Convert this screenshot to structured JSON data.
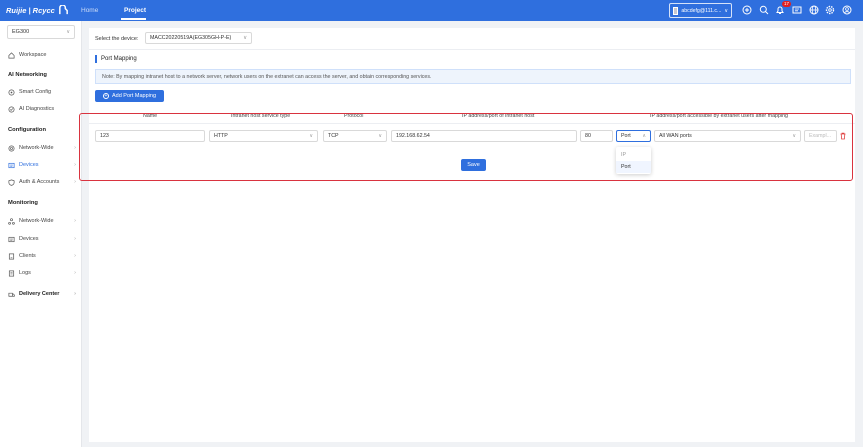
{
  "header": {
    "brand": "Ruijie | Rcycc",
    "nav": [
      "Home",
      "Project"
    ],
    "active_nav": "Project",
    "account": "abcdefg@111.c...",
    "notification_count": "17",
    "icons": [
      "add-circle-icon",
      "search-icon",
      "bell-icon",
      "message-icon",
      "globe-icon",
      "settings-icon",
      "user-icon"
    ]
  },
  "sidebar": {
    "device_select": "EG300",
    "workspace": "Workspace",
    "sections": [
      {
        "title": "AI Networking",
        "items": [
          "Smart Config",
          "AI Diagnostics"
        ]
      },
      {
        "title": "Configuration",
        "items": [
          "Network-Wide",
          "Devices",
          "Auth & Accounts"
        ]
      },
      {
        "title": "Monitoring",
        "items": [
          "Network-Wide",
          "Devices",
          "Clients",
          "Logs"
        ]
      }
    ],
    "delivery_center": "Delivery Center",
    "active_item": "Devices"
  },
  "content": {
    "device_label": "Select the device:",
    "device_value": "MACC20220519A(EG305GH-P-E)",
    "section_title": "Port Mapping",
    "note": "Note: By mapping intranet host to a network server, network users on the extranet can access the server, and obtain corresponding services.",
    "add_button": "Add Port Mapping",
    "columns": [
      "Name",
      "Intranet host service type",
      "Protocol",
      "IP address/port of intranet host",
      "IP address/port accessible by extranet users after mapping"
    ],
    "row": {
      "name": "123",
      "service_type": "HTTP",
      "protocol": "TCP",
      "ip": "192.168.62.54",
      "port": "80",
      "mapping_type": "Port",
      "wan": "All WAN ports",
      "example_placeholder": "Exampl..."
    },
    "dropdown_options": [
      "IP",
      "Port"
    ],
    "dropdown_selected": "Port",
    "save_button": "Save"
  },
  "colors": {
    "primary": "#2f6fde",
    "highlight_border": "#d9333f",
    "delete": "#e04040"
  }
}
